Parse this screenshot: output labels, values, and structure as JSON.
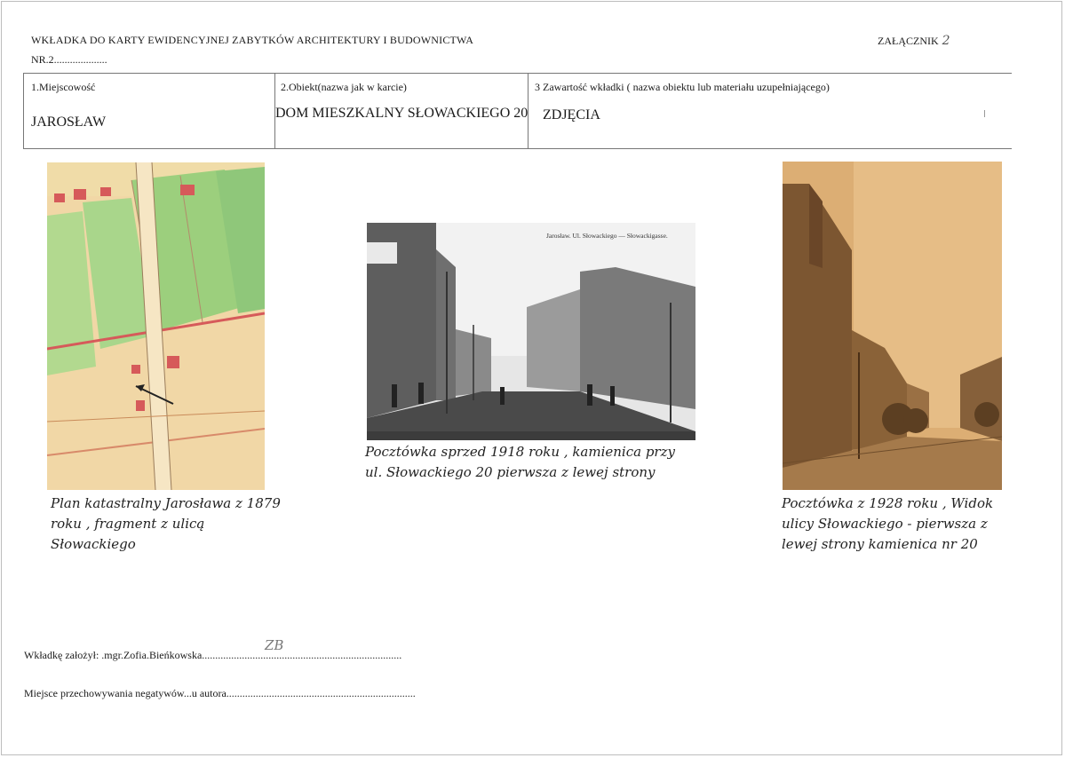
{
  "header": {
    "title": "WKŁADKA DO KARTY EWIDENCYJNEJ ZABYTKÓW ARCHITEKTURY I BUDOWNICTWA",
    "number": "NR.2....................",
    "annex_label": "ZAŁĄCZNIK",
    "annex_number": "2"
  },
  "table": {
    "col1": {
      "label": "1.Miejscowość",
      "value": "JAROSŁAW"
    },
    "col2": {
      "label": "2.Obiekt(nazwa jak w karcie)",
      "value": "DOM MIESZKALNY SŁOWACKIEGO 20"
    },
    "col3": {
      "label": "3 Zawartość wkładki ( nazwa obiektu lub materiału uzupełniającego)",
      "value": "ZDJĘCIA"
    }
  },
  "images": {
    "postcard1_caption_print": "Jarosław. Ul. Słowackiego — Słowackigasse."
  },
  "captions": {
    "map": "Plan katastralny Jarosława z 1879 roku , fragment z ulicą Słowackiego",
    "postcard1": "Pocztówka sprzed 1918 roku , kamienica przy ul. Słowackiego 20 pierwsza z lewej strony",
    "postcard2": "Pocztówka z 1928 roku , Widok ulicy Słowackiego - pierwsza z lewej strony kamienica nr 20"
  },
  "footer": {
    "created_by": "Wkładkę założył: .mgr.Zofia.Bieńkowska...........................................................................",
    "negatives": "Miejsce przechowywania negatywów...u autora.......................................................................",
    "initials": "ZB"
  },
  "colors": {
    "border": "#777777",
    "map_paper": "#f1d7a6",
    "map_green": "#9ccf7d",
    "map_red": "#d65a5a",
    "sepia_sky": "#dcae74"
  }
}
